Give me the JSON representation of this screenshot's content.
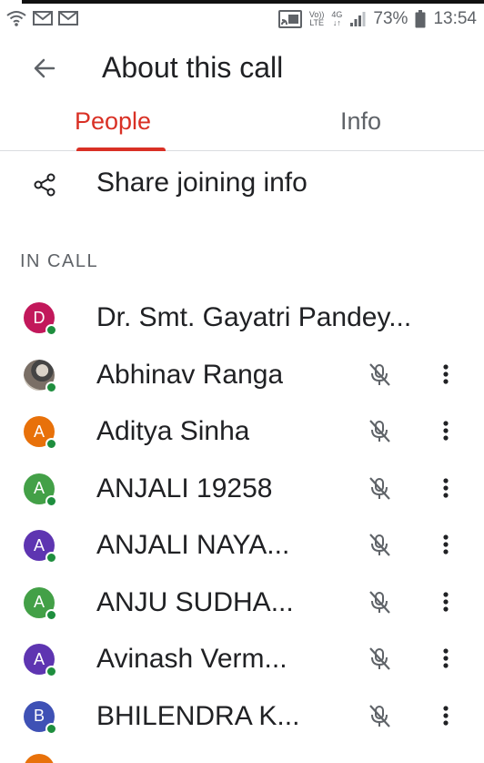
{
  "status_bar": {
    "battery": "73%",
    "time": "13:54",
    "volte_top": "Vo))",
    "volte_bottom": "LTE",
    "net_top": "4G",
    "net_bottom": "↓↑"
  },
  "header": {
    "title": "About this call"
  },
  "tabs": [
    {
      "label": "People",
      "active": true
    },
    {
      "label": "Info",
      "active": false
    }
  ],
  "share": {
    "label": "Share joining info"
  },
  "section": {
    "label": "IN CALL"
  },
  "participants": [
    {
      "initial": "D",
      "name": "Dr. Smt. Gayatri Pandey...",
      "color": "#c2185b"
    },
    {
      "initial": "",
      "name": "Abhinav Ranga",
      "color": "photo"
    },
    {
      "initial": "A",
      "name": "Aditya Sinha",
      "color": "#e8710a"
    },
    {
      "initial": "A",
      "name": "ANJALI 19258",
      "color": "#43a047"
    },
    {
      "initial": "A",
      "name": "ANJALI NAYA...",
      "color": "#5e35b1"
    },
    {
      "initial": "A",
      "name": "ANJU SUDHA...",
      "color": "#43a047"
    },
    {
      "initial": "A",
      "name": "Avinash Verm...",
      "color": "#5e35b1"
    },
    {
      "initial": "B",
      "name": "BHILENDRA K...",
      "color": "#3f51b5"
    }
  ]
}
